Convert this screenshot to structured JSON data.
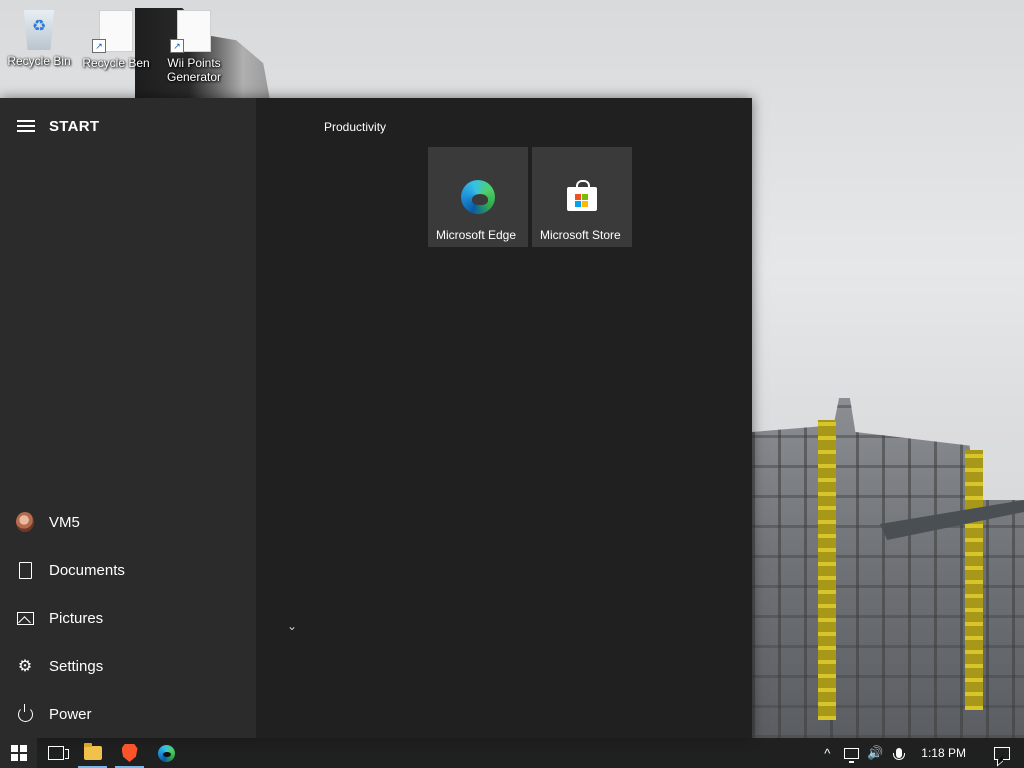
{
  "desktop": {
    "icons": [
      {
        "label": "Recycle Bin",
        "icon": "recycle-bin-icon"
      },
      {
        "label": "Recycle Ben",
        "icon": "document-icon"
      },
      {
        "label": "Wii Points Generator",
        "icon": "document-icon"
      }
    ]
  },
  "start_menu": {
    "title": "START",
    "left_items": [
      {
        "label": "VM5",
        "icon": "user-avatar-icon"
      },
      {
        "label": "Documents",
        "icon": "document-icon"
      },
      {
        "label": "Pictures",
        "icon": "pictures-icon"
      },
      {
        "label": "Settings",
        "icon": "gear-icon"
      },
      {
        "label": "Power",
        "icon": "power-icon"
      }
    ],
    "group_label": "Productivity",
    "tiles": [
      {
        "label": "Microsoft Edge",
        "icon": "edge-icon"
      },
      {
        "label": "Microsoft Store",
        "icon": "store-icon"
      }
    ],
    "collapse_glyph": "⌄"
  },
  "taskbar": {
    "apps": [
      {
        "name": "start",
        "icon": "windows-icon"
      },
      {
        "name": "task-view",
        "icon": "task-view-icon"
      },
      {
        "name": "file-explorer",
        "icon": "folder-icon"
      },
      {
        "name": "brave",
        "icon": "brave-icon"
      },
      {
        "name": "edge",
        "icon": "edge-icon"
      }
    ],
    "tray": {
      "chevron": "^",
      "volume": "🔊",
      "clock": "1:18 PM"
    }
  },
  "colors": {
    "start_bg": "#202020",
    "start_left_bg": "#2b2b2b",
    "tile_bg": "#3a3a3a",
    "taskbar_bg": "#101010",
    "accent": "#76b9ed"
  }
}
